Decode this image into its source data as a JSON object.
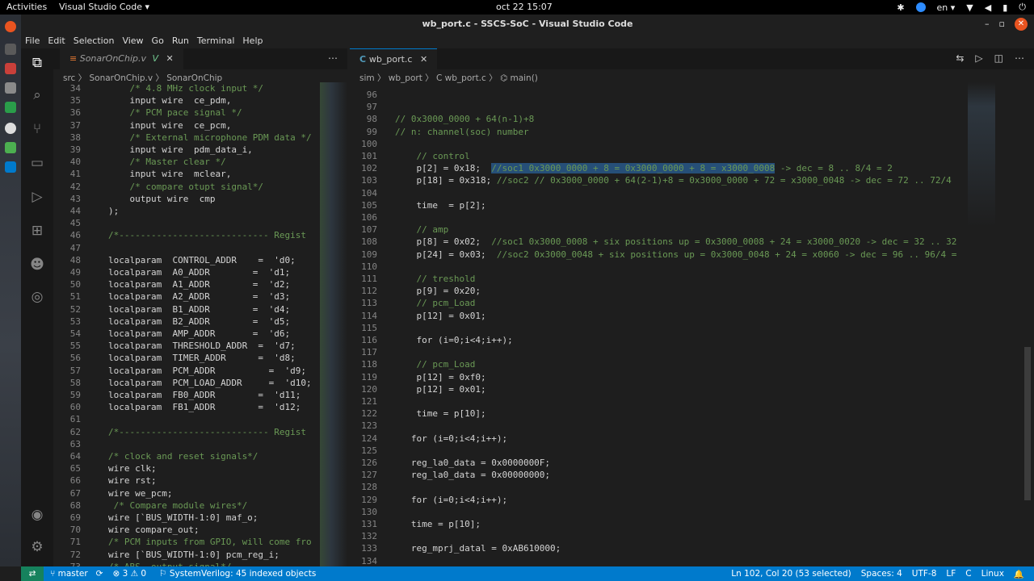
{
  "topbar": {
    "activities": "Activities",
    "app_name": "Visual Studio Code ▾",
    "clock": "oct 22  15:07",
    "lang": "en ▾"
  },
  "window": {
    "title": "wb_port.c - SSCS-SoC - Visual Studio Code"
  },
  "menu": [
    "File",
    "Edit",
    "Selection",
    "View",
    "Go",
    "Run",
    "Terminal",
    "Help"
  ],
  "activity_icons": [
    "explorer-icon",
    "search-icon",
    "source-control-icon",
    "remote-explorer-icon",
    "run-debug-icon",
    "extensions-icon",
    "alien-icon",
    "esp-icon",
    "account-icon",
    "manage-gear-icon"
  ],
  "left_editor": {
    "tab_label": "SonarOnChip.v",
    "tab_mod": "V",
    "crumbs": "src  〉 SonarOnChip.v  〉 SonarOnChip",
    "lines": [
      {
        "n": "34",
        "t": "    /* 4.8 MHz clock input */",
        "c": "cmt"
      },
      {
        "n": "35",
        "t": "    input wire  ce_pdm,",
        "c": ""
      },
      {
        "n": "36",
        "t": "    /* PCM pace signal */",
        "c": "cmt"
      },
      {
        "n": "37",
        "t": "    input wire  ce_pcm,",
        "c": ""
      },
      {
        "n": "38",
        "t": "    /* External microphone PDM data */",
        "c": "cmt"
      },
      {
        "n": "39",
        "t": "    input wire  pdm_data_i,",
        "c": ""
      },
      {
        "n": "40",
        "t": "    /* Master clear */",
        "c": "cmt"
      },
      {
        "n": "41",
        "t": "    input wire  mclear,",
        "c": ""
      },
      {
        "n": "42",
        "t": "    /* compare otupt signal*/",
        "c": "cmt"
      },
      {
        "n": "43",
        "t": "    output wire  cmp",
        "c": ""
      },
      {
        "n": "44",
        "t": ");",
        "c": ""
      },
      {
        "n": "45",
        "t": "",
        "c": ""
      },
      {
        "n": "46",
        "t": "/*---------------------------- Regist",
        "c": "cmt"
      },
      {
        "n": "47",
        "t": "",
        "c": ""
      },
      {
        "n": "48",
        "t": "localparam  CONTROL_ADDR    =  'd0;",
        "c": ""
      },
      {
        "n": "49",
        "t": "localparam  A0_ADDR        =  'd1;",
        "c": ""
      },
      {
        "n": "50",
        "t": "localparam  A1_ADDR        =  'd2;",
        "c": ""
      },
      {
        "n": "51",
        "t": "localparam  A2_ADDR        =  'd3;",
        "c": ""
      },
      {
        "n": "52",
        "t": "localparam  B1_ADDR        =  'd4;",
        "c": ""
      },
      {
        "n": "53",
        "t": "localparam  B2_ADDR        =  'd5;",
        "c": ""
      },
      {
        "n": "54",
        "t": "localparam  AMP_ADDR       =  'd6;",
        "c": ""
      },
      {
        "n": "55",
        "t": "localparam  THRESHOLD_ADDR  =  'd7;",
        "c": ""
      },
      {
        "n": "56",
        "t": "localparam  TIMER_ADDR      =  'd8;",
        "c": ""
      },
      {
        "n": "57",
        "t": "localparam  PCM_ADDR          =  'd9;",
        "c": ""
      },
      {
        "n": "58",
        "t": "localparam  PCM_LOAD_ADDR     =  'd10;",
        "c": ""
      },
      {
        "n": "59",
        "t": "localparam  FB0_ADDR        =  'd11;",
        "c": ""
      },
      {
        "n": "60",
        "t": "localparam  FB1_ADDR        =  'd12;",
        "c": ""
      },
      {
        "n": "61",
        "t": "",
        "c": ""
      },
      {
        "n": "62",
        "t": "/*---------------------------- Regist",
        "c": "cmt"
      },
      {
        "n": "63",
        "t": "",
        "c": ""
      },
      {
        "n": "64",
        "t": "/* clock and reset signals*/",
        "c": "cmt"
      },
      {
        "n": "65",
        "t": "wire clk;",
        "c": ""
      },
      {
        "n": "66",
        "t": "wire rst;",
        "c": ""
      },
      {
        "n": "67",
        "t": "wire we_pcm;",
        "c": ""
      },
      {
        "n": "68",
        "t": " /* Compare module wires*/",
        "c": "cmt"
      },
      {
        "n": "69",
        "t": "wire [`BUS_WIDTH-1:0] maf_o;",
        "c": ""
      },
      {
        "n": "70",
        "t": "wire compare_out;",
        "c": ""
      },
      {
        "n": "71",
        "t": "/* PCM inputs from GPIO, will come fro",
        "c": "cmt"
      },
      {
        "n": "72",
        "t": "wire [`BUS_WIDTH-1:0] pcm_reg_i;",
        "c": ""
      },
      {
        "n": "73",
        "t": "/* ABS  output signal*/",
        "c": "cmt"
      }
    ]
  },
  "right_editor": {
    "tab_label": "wb_port.c",
    "crumbs": "sim  〉 wb_port  〉 C  wb_port.c  〉 ⌬ main()",
    "lines": [
      {
        "n": "96",
        "t": "",
        "c": ""
      },
      {
        "n": "97",
        "t": "",
        "c": ""
      },
      {
        "n": "98",
        "t": "// 0x3000_0000 + 64(n-1)+8",
        "c": "cmt"
      },
      {
        "n": "99",
        "t": "// n: channel(soc) number",
        "c": "cmt"
      },
      {
        "n": "100",
        "t": "",
        "c": ""
      },
      {
        "n": "101",
        "t": "    // control",
        "c": "cmt"
      },
      {
        "n": "102",
        "t": "    p[2] = 0x18;  //soc1 0x3000_0000 + 8 = 0x3000_0000 + 8 = x3000_0008 -> dec = 8 .. 8/4 = 2",
        "c": "sel"
      },
      {
        "n": "103",
        "t": "    p[18] = 0x318; //soc2 // 0x3000_0000 + 64(2-1)+8 = 0x3000_0000 + 72 = x3000_0048 -> dec = 72 .. 72/4",
        "c": "mix"
      },
      {
        "n": "104",
        "t": "",
        "c": ""
      },
      {
        "n": "105",
        "t": "    time  = p[2];",
        "c": ""
      },
      {
        "n": "106",
        "t": "",
        "c": ""
      },
      {
        "n": "107",
        "t": "    // amp",
        "c": "cmt"
      },
      {
        "n": "108",
        "t": "    p[8] = 0x02;  //soc1 0x3000_0008 + six positions up = 0x3000_0008 + 24 = x3000_0020 -> dec = 32 .. 32",
        "c": "mix"
      },
      {
        "n": "109",
        "t": "    p[24] = 0x03;  //soc2 0x3000_0048 + six positions up = 0x3000_0048 + 24 = x0060 -> dec = 96 .. 96/4 =",
        "c": "mix"
      },
      {
        "n": "110",
        "t": "",
        "c": ""
      },
      {
        "n": "111",
        "t": "    // treshold",
        "c": "cmt"
      },
      {
        "n": "112",
        "t": "    p[9] = 0x20;",
        "c": ""
      },
      {
        "n": "113",
        "t": "    // pcm_Load",
        "c": "cmt"
      },
      {
        "n": "114",
        "t": "    p[12] = 0x01;",
        "c": ""
      },
      {
        "n": "115",
        "t": "",
        "c": ""
      },
      {
        "n": "116",
        "t": "    for (i=0;i<4;i++);",
        "c": ""
      },
      {
        "n": "117",
        "t": "",
        "c": ""
      },
      {
        "n": "118",
        "t": "    // pcm_Load",
        "c": "cmt"
      },
      {
        "n": "119",
        "t": "    p[12] = 0xf0;",
        "c": ""
      },
      {
        "n": "120",
        "t": "    p[12] = 0x01;",
        "c": ""
      },
      {
        "n": "121",
        "t": "",
        "c": ""
      },
      {
        "n": "122",
        "t": "    time = p[10];",
        "c": ""
      },
      {
        "n": "123",
        "t": "",
        "c": ""
      },
      {
        "n": "124",
        "t": "   for (i=0;i<4;i++);",
        "c": ""
      },
      {
        "n": "125",
        "t": "",
        "c": ""
      },
      {
        "n": "126",
        "t": "   reg_la0_data = 0x0000000F;",
        "c": ""
      },
      {
        "n": "127",
        "t": "   reg_la0_data = 0x00000000;",
        "c": ""
      },
      {
        "n": "128",
        "t": "",
        "c": ""
      },
      {
        "n": "129",
        "t": "   for (i=0;i<4;i++);",
        "c": ""
      },
      {
        "n": "130",
        "t": "",
        "c": ""
      },
      {
        "n": "131",
        "t": "   time = p[10];",
        "c": ""
      },
      {
        "n": "132",
        "t": "",
        "c": ""
      },
      {
        "n": "133",
        "t": "   reg_mprj_datal = 0xAB610000;",
        "c": ""
      },
      {
        "n": "134",
        "t": "",
        "c": ""
      }
    ]
  },
  "status": {
    "branch": "master",
    "problems": "⊗ 3 ⚠ 0",
    "indexer": "SystemVerilog: 45 indexed objects",
    "position": "Ln 102, Col 20 (53 selected)",
    "spaces": "Spaces: 4",
    "encoding": "UTF-8",
    "eol": "LF",
    "lang": "C",
    "platform": "Linux"
  },
  "colors": {
    "accent": "#007acc",
    "selection": "#264f78",
    "comment": "#6a9955",
    "keyword": "#569cd6"
  }
}
